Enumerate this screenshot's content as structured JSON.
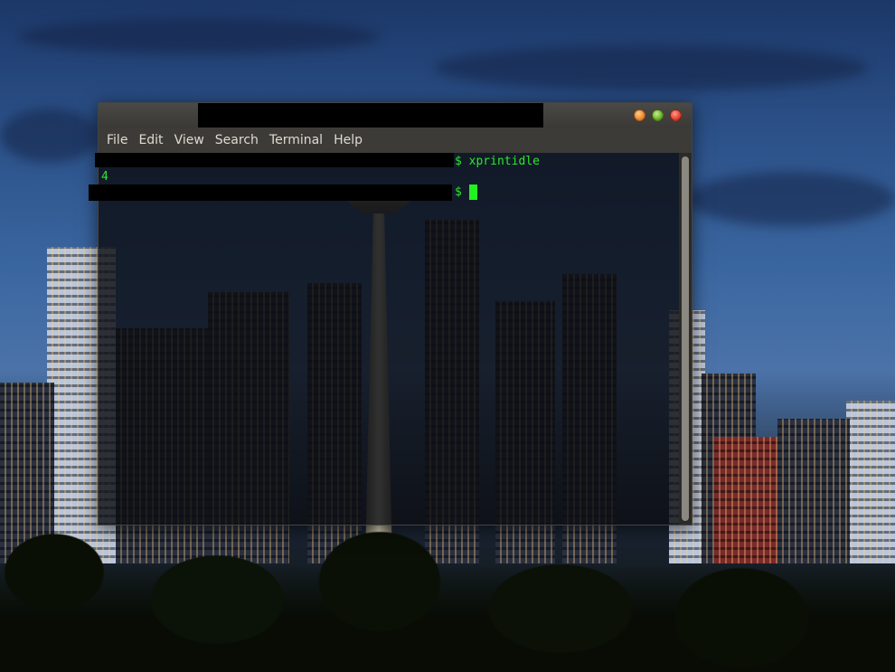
{
  "window": {
    "title": "",
    "controls": {
      "minimize_icon": "minimize-icon",
      "maximize_icon": "maximize-icon",
      "close_icon": "close-icon"
    }
  },
  "menubar": {
    "items": [
      "File",
      "Edit",
      "View",
      "Search",
      "Terminal",
      "Help"
    ]
  },
  "terminal": {
    "line1_suffix": "$ xprintidle",
    "line2_output": "4",
    "line3_prompt": "$",
    "text_color": "#2ee62e"
  }
}
